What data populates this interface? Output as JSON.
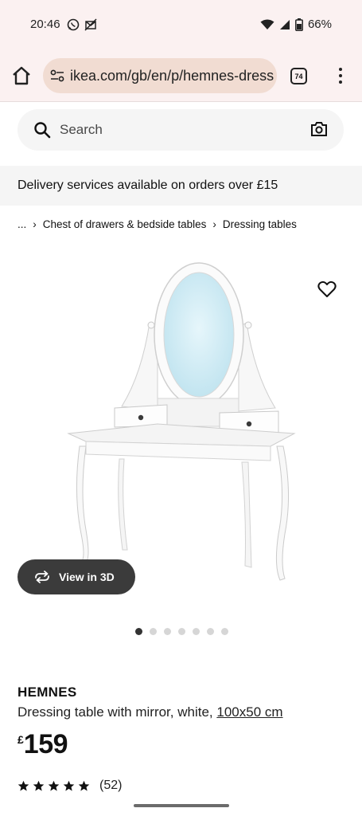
{
  "status_bar": {
    "time": "20:46",
    "battery": "66%",
    "icons": [
      "whatsapp-icon",
      "mail-off-icon",
      "wifi-icon",
      "signal-icon",
      "battery-icon"
    ]
  },
  "browser": {
    "url": "ikea.com/gb/en/p/hemnes-dress",
    "tab_count": "74"
  },
  "search": {
    "placeholder": "Search"
  },
  "banner": {
    "text": "Delivery services available on orders over £15"
  },
  "breadcrumb": {
    "items": [
      "...",
      "Chest of drawers & bedside tables",
      "Dressing tables"
    ]
  },
  "gallery": {
    "view_3d_label": "View in 3D",
    "image_count": 7,
    "active_index": 0
  },
  "product": {
    "name": "HEMNES",
    "description": "Dressing table with mirror, white,",
    "size": "100x50 cm",
    "currency": "£",
    "price": "159",
    "rating_stars": 5,
    "review_count": "(52)"
  },
  "colors": {
    "browser_bg": "#fbf1f1",
    "url_pill": "#f1dcd2",
    "view3d_bg": "#3b3b3b",
    "panel_gray": "#f5f5f5"
  }
}
